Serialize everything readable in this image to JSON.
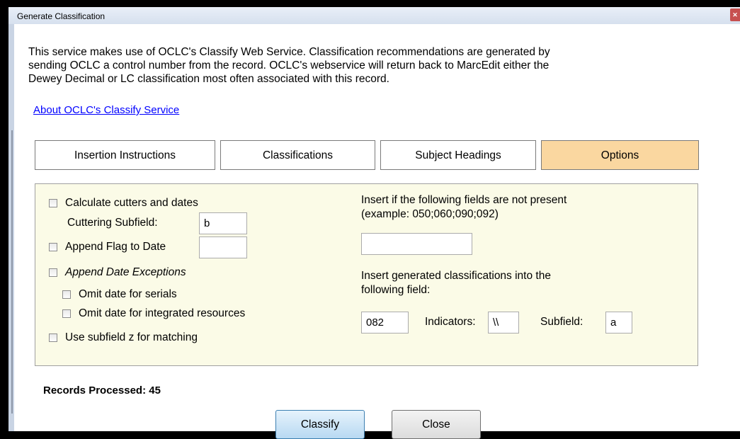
{
  "window": {
    "title": "Generate Classification",
    "close_glyph": "✕"
  },
  "intro_text": "This service makes use of OCLC's Classify Web Service.  Classification recommendations are generated by sending OCLC a control number from the record.  OCLC's webservice will return back to MarcEdit either the Dewey Decimal or LC classification most often associated with this record.",
  "about_link": "About OCLC's Classify Service",
  "tabs": [
    {
      "label": "Insertion Instructions",
      "active": false
    },
    {
      "label": "Classifications",
      "active": false
    },
    {
      "label": "Subject Headings",
      "active": false
    },
    {
      "label": "Options",
      "active": true
    }
  ],
  "options": {
    "calculate_cutters": {
      "label": "Calculate cutters and dates",
      "checked": false
    },
    "cuttering_subfield": {
      "label": "Cuttering Subfield:",
      "value": "b"
    },
    "append_flag": {
      "label": "Append Flag to Date",
      "checked": false,
      "value": ""
    },
    "append_date_exceptions": {
      "label": "Append Date Exceptions",
      "checked": false
    },
    "omit_serials": {
      "label": "Omit date for serials",
      "checked": false
    },
    "omit_integrated": {
      "label": "Omit date for integrated resources",
      "checked": false
    },
    "use_subfield_z": {
      "label": "Use subfield z for matching",
      "checked": false
    },
    "insert_if_missing": {
      "label_line1": "Insert if the following fields are not present",
      "label_line2": "(example:  050;060;090;092)",
      "value": ""
    },
    "insert_into": {
      "label_line1": "Insert generated classifications into the",
      "label_line2": "following field:",
      "field_value": "082",
      "indicators_label": "Indicators:",
      "indicators_value": "\\\\",
      "subfield_label": "Subfield:",
      "subfield_value": "a"
    }
  },
  "records_processed": "Records Processed: 45",
  "buttons": {
    "classify": "Classify",
    "close": "Close"
  },
  "colors": {
    "active_tab": "#fad7a0",
    "panel_bg": "#fbfbe7",
    "link": "#0000ff"
  }
}
